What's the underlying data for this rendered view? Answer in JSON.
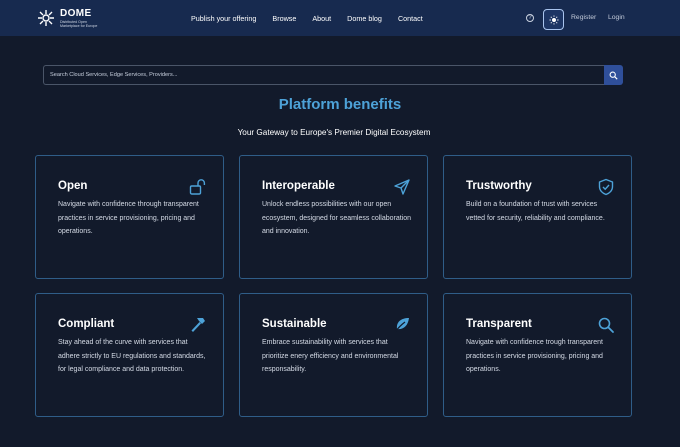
{
  "header": {
    "logo_title": "DOME",
    "logo_subtitle": "Distributed Open Marketplace for Europe",
    "nav": [
      "Publish your offering",
      "Browse",
      "About",
      "Dome blog",
      "Contact"
    ],
    "help_glyph": "?",
    "register": "Register",
    "login": "Login",
    "colors": {
      "bar": "#172a4f",
      "accent": "#4da2d8"
    }
  },
  "search": {
    "placeholder": "Search Cloud Services, Edge Services, Providers...",
    "value": ""
  },
  "main": {
    "heading": "Platform benefits",
    "subheading": "Your Gateway to Europe's Premier Digital Ecosystem"
  },
  "cards": [
    {
      "title": "Open",
      "icon": "unlock-icon",
      "text": "Navigate with confidence through transparent practices in service provisioning, pricing and operations."
    },
    {
      "title": "Interoperable",
      "icon": "send-icon",
      "text": "Unlock endless possibilities with our open ecosystem, designed for seamless collaboration and innovation."
    },
    {
      "title": "Trustworthy",
      "icon": "shield-check-icon",
      "text": "Build on a foundation of trust with services vetted for security, reliability and compliance."
    },
    {
      "title": "Compliant",
      "icon": "hammer-icon",
      "text": "Stay ahead of the curve with services that adhere strictly to EU regulations and standards, for legal compliance and data protection."
    },
    {
      "title": "Sustainable",
      "icon": "leaf-icon",
      "text": "Embrace sustainability with services that prioritize enery efficiency and environmental responsability."
    },
    {
      "title": "Transparent",
      "icon": "search-icon",
      "text": "Navigate with confidence trough transparent practices in service provisioning, pricing and operations."
    }
  ]
}
